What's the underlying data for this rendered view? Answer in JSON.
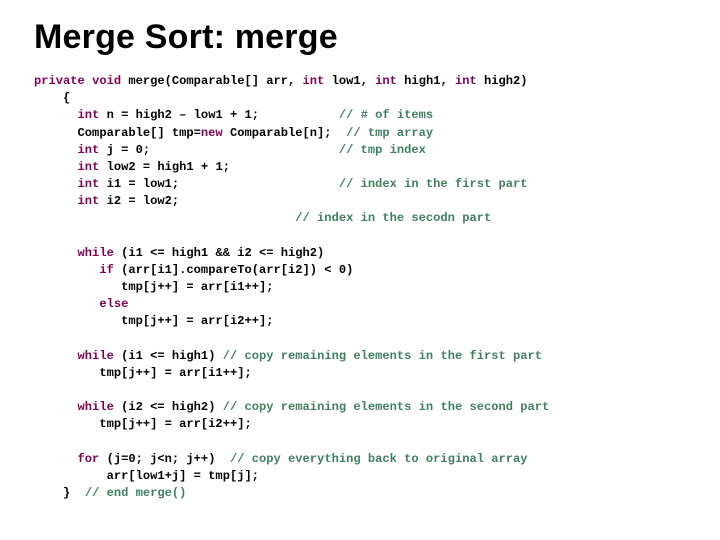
{
  "title": "Merge Sort: merge",
  "kw": {
    "private": "private",
    "void": "void",
    "int": "int",
    "new": "new",
    "while": "while",
    "if": "if",
    "else": "else",
    "for": "for"
  },
  "t": {
    "sig_a": " merge(Comparable[] arr, ",
    "sig_b": " low1, ",
    "sig_c": " high1, ",
    "sig_d": " high2)",
    "lbrace": "    {",
    "l1a": " n = high2 – low1 + 1;           ",
    "l2a": "      Comparable[] tmp=",
    "l2b": " Comparable[n];  ",
    "l3a": " j = 0;                          ",
    "l4a": " low2 = high1 + 1;",
    "l5a": " i1 = low1;                      ",
    "l6a": " i2 = low2;",
    "l6pad": "                                    ",
    "w1a": " (i1 <= high1 && i2 <= high2)",
    "if1a": " (arr[i1].compareTo(arr[i2]) < 0)",
    "a1": "            tmp[j++] = arr[i1++];",
    "a2": "            tmp[j++] = arr[i2++];",
    "w2a": " (i1 <= high1) ",
    "a3": "         tmp[j++] = arr[i1++];",
    "w3a": " (i2 <= high2) ",
    "a4": "         tmp[j++] = arr[i2++];",
    "for1a": " (j=0; j<n; j++)  ",
    "a5": "          arr[low1+j] = tmp[j];",
    "rbrace": "    }  "
  },
  "c": {
    "c1": "// # of items",
    "c2": "// tmp array",
    "c3": "// tmp index",
    "c5": "// index in the first part",
    "c6": "// index in the secodn part",
    "c7": "// copy remaining elements in the first part",
    "c8": "// copy remaining elements in the second part",
    "c9": "// copy everything back to original array",
    "c10": "// end merge()"
  }
}
